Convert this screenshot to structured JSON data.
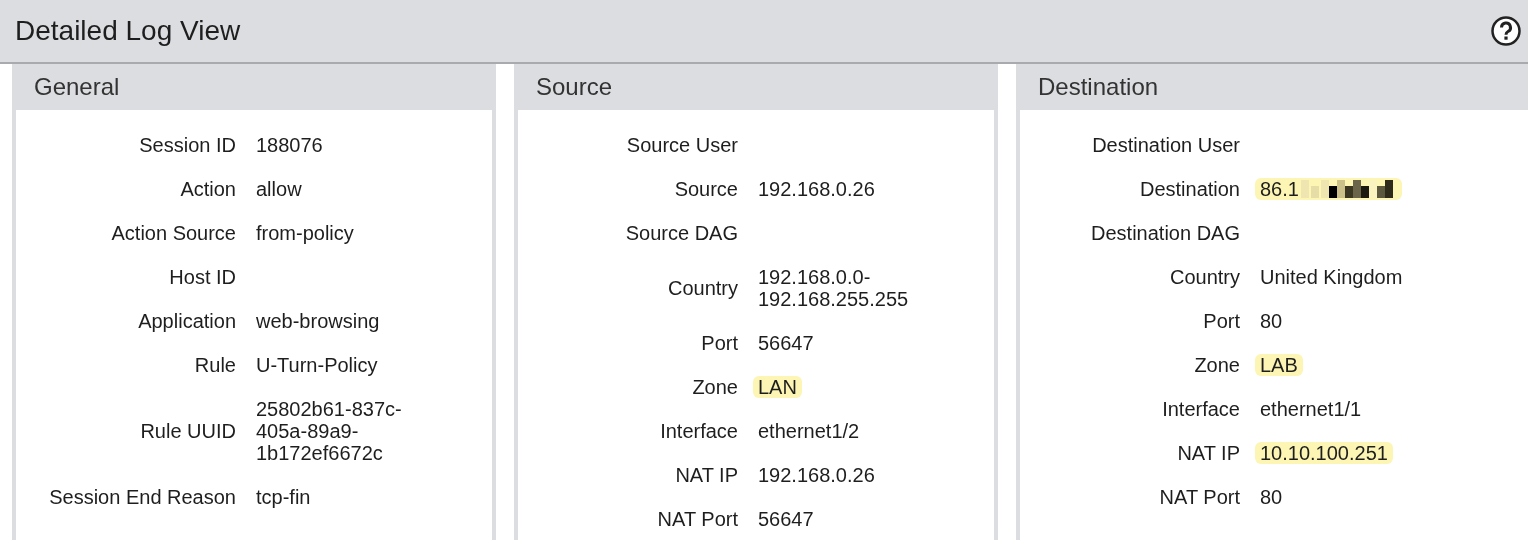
{
  "header": {
    "title": "Detailed Log View"
  },
  "panels": [
    {
      "title": "General",
      "rows": [
        {
          "label": "Session ID",
          "value": [
            "188076"
          ]
        },
        {
          "label": "Action",
          "value": [
            "allow"
          ]
        },
        {
          "label": "Action Source",
          "value": [
            "from-policy"
          ]
        },
        {
          "label": "Host ID",
          "value": []
        },
        {
          "label": "Application",
          "value": [
            "web-browsing"
          ]
        },
        {
          "label": "Rule",
          "value": [
            "U-Turn-Policy"
          ]
        },
        {
          "label": "Rule UUID",
          "value": [
            "25802b61-837c-",
            "405a-89a9-",
            "1b172ef6672c"
          ]
        },
        {
          "label": "Session End Reason",
          "value": [
            "tcp-fin"
          ]
        }
      ]
    },
    {
      "title": "Source",
      "rows": [
        {
          "label": "Source User",
          "value": []
        },
        {
          "label": "Source",
          "value": [
            "192.168.0.26"
          ]
        },
        {
          "label": "Source DAG",
          "value": []
        },
        {
          "label": "Country",
          "value": [
            "192.168.0.0-",
            "192.168.255.255"
          ]
        },
        {
          "label": "Port",
          "value": [
            "56647"
          ]
        },
        {
          "label": "Zone",
          "value": [
            "LAN"
          ],
          "highlight": true
        },
        {
          "label": "Interface",
          "value": [
            "ethernet1/2"
          ]
        },
        {
          "label": "NAT IP",
          "value": [
            "192.168.0.26"
          ]
        },
        {
          "label": "NAT Port",
          "value": [
            "56647"
          ]
        }
      ]
    },
    {
      "title": "Destination",
      "rows": [
        {
          "label": "Destination User",
          "value": []
        },
        {
          "label": "Destination",
          "value": [
            "86.1"
          ],
          "highlight": true,
          "redacted": true
        },
        {
          "label": "Destination DAG",
          "value": []
        },
        {
          "label": "Country",
          "value": [
            "United Kingdom"
          ]
        },
        {
          "label": "Port",
          "value": [
            "80"
          ]
        },
        {
          "label": "Zone",
          "value": [
            "LAB"
          ],
          "highlight": true
        },
        {
          "label": "Interface",
          "value": [
            "ethernet1/1"
          ]
        },
        {
          "label": "NAT IP",
          "value": [
            "10.10.100.251"
          ],
          "highlight": true
        },
        {
          "label": "NAT Port",
          "value": [
            "80"
          ]
        }
      ]
    }
  ]
}
